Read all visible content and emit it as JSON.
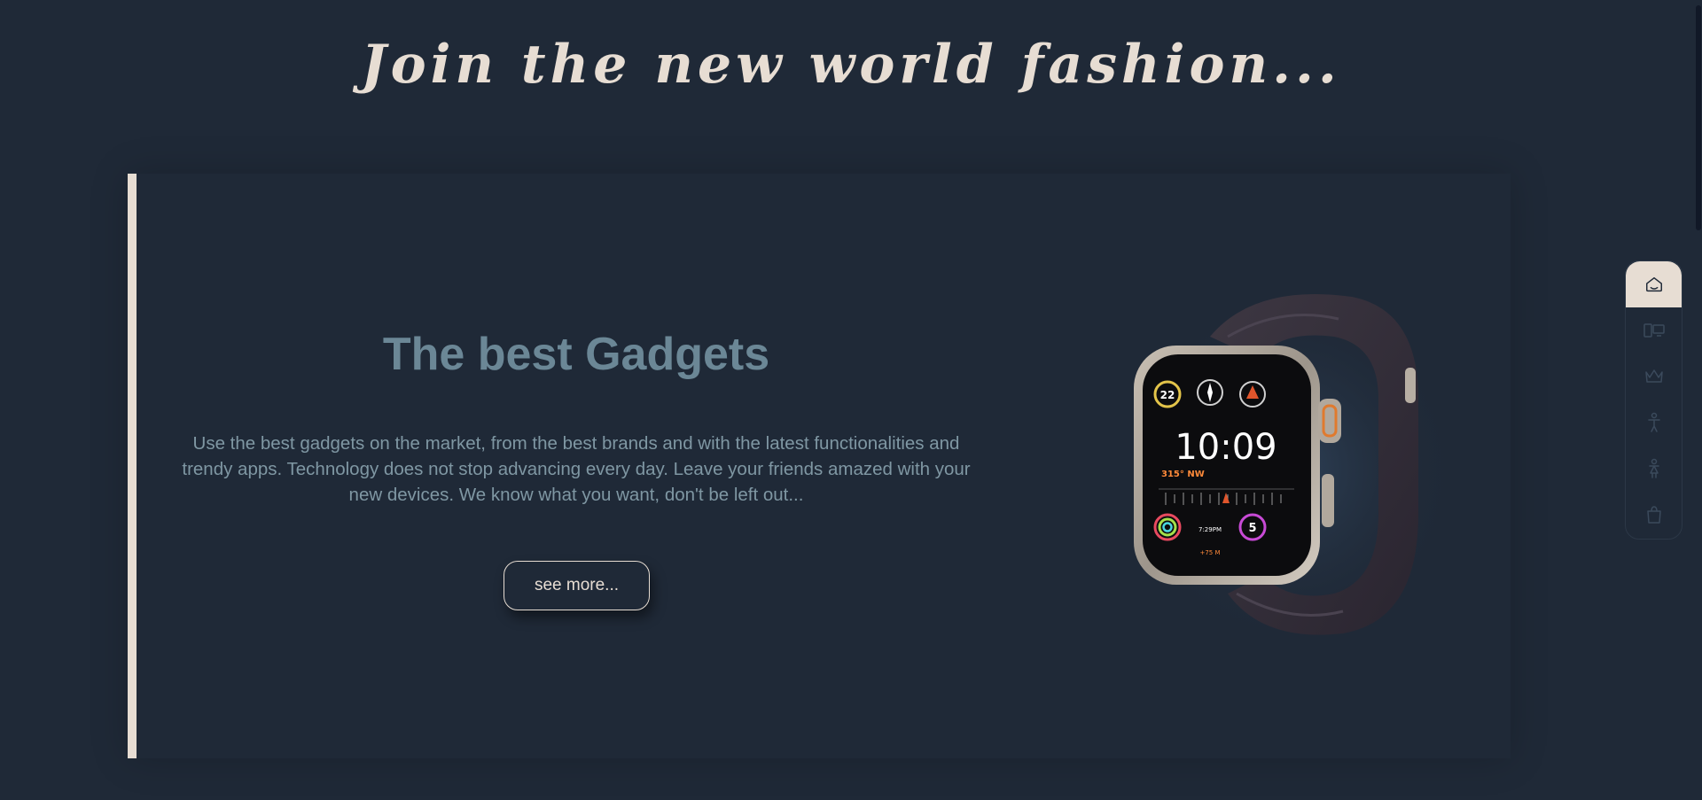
{
  "hero": {
    "headline": "Join the new world fashion..."
  },
  "card": {
    "title": "The best Gadgets",
    "description": "Use the best gadgets on the market, from the best brands and with the latest functionalities and trendy apps. Technology does not stop advancing every day. Leave your friends amazed with your new devices. We know what you want, don't be left out...",
    "button_label": "see more...",
    "product_image": "smartwatch",
    "watch_face": {
      "time": "10:09",
      "left_complication": "22",
      "right_complication": "5",
      "heading": "315° NW",
      "small_time": "7:29PM",
      "altitude": "+75 M"
    }
  },
  "sidebar": {
    "items": [
      {
        "icon": "home-icon",
        "active": true
      },
      {
        "icon": "devices-icon",
        "active": false
      },
      {
        "icon": "crown-icon",
        "active": false
      },
      {
        "icon": "man-icon",
        "active": false
      },
      {
        "icon": "woman-icon",
        "active": false
      },
      {
        "icon": "shopping-bag-icon",
        "active": false
      }
    ]
  },
  "colors": {
    "background": "#1f2937",
    "accent": "#e7ddd3",
    "title": "#6b8796",
    "text": "#7f97a3"
  }
}
